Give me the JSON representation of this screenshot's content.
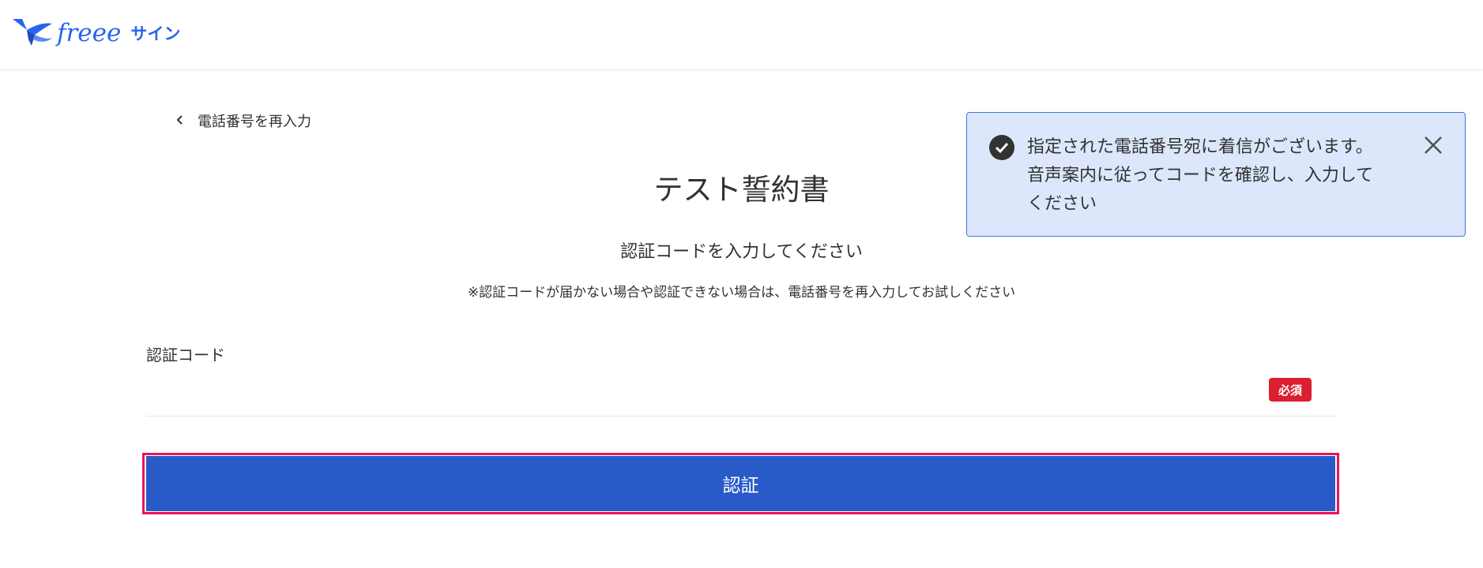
{
  "header": {
    "logo_text": "freee",
    "logo_sub": "サイン",
    "brand_color": "#2864f0"
  },
  "back_link": {
    "label": "電話番号を再入力",
    "icon": "chevron-left-icon"
  },
  "main": {
    "title": "テスト誓約書",
    "subtitle": "認証コードを入力してください",
    "note": "※認証コードが届かない場合や認証できない場合は、電話番号を再入力してお試しください"
  },
  "form": {
    "code_label": "認証コード",
    "code_value": "",
    "code_placeholder": "",
    "required_label": "必須",
    "required_color": "#dc1e32",
    "submit_label": "認証",
    "submit_color": "#285ac8",
    "submit_highlight_color": "#e8145a"
  },
  "toast": {
    "message": "指定された電話番号宛に着信がございます。\n音声案内に従ってコードを確認し、入力して\nください",
    "check_icon": "check-circle-icon",
    "close_icon": "close-icon",
    "background": "#dce7fc",
    "border": "#3c78e6"
  }
}
